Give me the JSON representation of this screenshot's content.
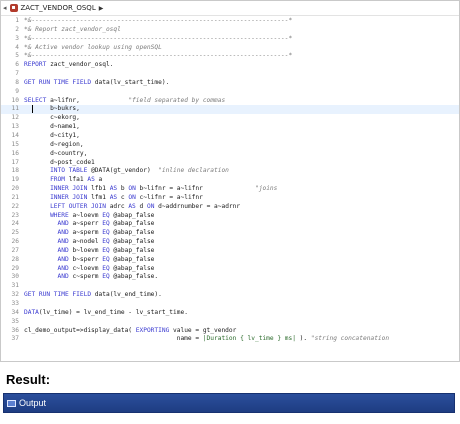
{
  "editor": {
    "breadcrumb": {
      "object_name": "ZACT_VENDOR_OSQL"
    },
    "lines": [
      {
        "n": "1",
        "parts": [
          {
            "t": "*&---------------------------------------------------------------------*",
            "c": "cm"
          }
        ]
      },
      {
        "n": "2",
        "parts": [
          {
            "t": "*& Report zact_vendor_osql",
            "c": "cm"
          }
        ]
      },
      {
        "n": "3",
        "parts": [
          {
            "t": "*&---------------------------------------------------------------------*",
            "c": "cm"
          }
        ]
      },
      {
        "n": "4",
        "parts": [
          {
            "t": "*& Active vendor lookup using openSQL",
            "c": "cm"
          }
        ]
      },
      {
        "n": "5",
        "parts": [
          {
            "t": "*&---------------------------------------------------------------------*",
            "c": "cm"
          }
        ]
      },
      {
        "n": "6",
        "parts": [
          {
            "t": "REPORT",
            "c": "kw"
          },
          {
            "t": " zact_vendor_osql.",
            "c": ""
          }
        ]
      },
      {
        "n": "7",
        "parts": []
      },
      {
        "n": "8",
        "parts": [
          {
            "t": "GET RUN TIME FIELD",
            "c": "kw"
          },
          {
            "t": " data(lv_start_time).",
            "c": ""
          }
        ]
      },
      {
        "n": "9",
        "parts": []
      },
      {
        "n": "10",
        "parts": [
          {
            "t": "SELECT",
            "c": "kw"
          },
          {
            "t": " a~lifnr,             ",
            "c": ""
          },
          {
            "t": "\"field separated by commas",
            "c": "cm"
          }
        ]
      },
      {
        "n": "11",
        "parts": [
          {
            "t": "       b~bukrs,",
            "c": ""
          }
        ],
        "cur": true
      },
      {
        "n": "12",
        "parts": [
          {
            "t": "       c~ekorg,",
            "c": ""
          }
        ]
      },
      {
        "n": "13",
        "parts": [
          {
            "t": "       d~name1,",
            "c": ""
          }
        ]
      },
      {
        "n": "14",
        "parts": [
          {
            "t": "       d~city1,",
            "c": ""
          }
        ]
      },
      {
        "n": "15",
        "parts": [
          {
            "t": "       d~region,",
            "c": ""
          }
        ]
      },
      {
        "n": "16",
        "parts": [
          {
            "t": "       d~country,",
            "c": ""
          }
        ]
      },
      {
        "n": "17",
        "parts": [
          {
            "t": "       d~post_code1",
            "c": ""
          }
        ]
      },
      {
        "n": "18",
        "parts": [
          {
            "t": "       ",
            "c": ""
          },
          {
            "t": "INTO TABLE",
            "c": "kw"
          },
          {
            "t": " @DATA(gt_vendor)  ",
            "c": ""
          },
          {
            "t": "\"inline declaration",
            "c": "cm"
          }
        ]
      },
      {
        "n": "19",
        "parts": [
          {
            "t": "       ",
            "c": ""
          },
          {
            "t": "FROM",
            "c": "kw"
          },
          {
            "t": " lfa1 ",
            "c": ""
          },
          {
            "t": "AS",
            "c": "kw"
          },
          {
            "t": " a",
            "c": ""
          }
        ]
      },
      {
        "n": "20",
        "parts": [
          {
            "t": "       ",
            "c": ""
          },
          {
            "t": "INNER JOIN",
            "c": "kw"
          },
          {
            "t": " lfb1 ",
            "c": ""
          },
          {
            "t": "AS",
            "c": "kw"
          },
          {
            "t": " b ",
            "c": ""
          },
          {
            "t": "ON",
            "c": "kw"
          },
          {
            "t": " b~lifnr = a~lifnr              ",
            "c": ""
          },
          {
            "t": "\"joins",
            "c": "cm"
          }
        ]
      },
      {
        "n": "21",
        "parts": [
          {
            "t": "       ",
            "c": ""
          },
          {
            "t": "INNER JOIN",
            "c": "kw"
          },
          {
            "t": " lfm1 ",
            "c": ""
          },
          {
            "t": "AS",
            "c": "kw"
          },
          {
            "t": " c ",
            "c": ""
          },
          {
            "t": "ON",
            "c": "kw"
          },
          {
            "t": " c~lifnr = a~lifnr",
            "c": ""
          }
        ]
      },
      {
        "n": "22",
        "parts": [
          {
            "t": "       ",
            "c": ""
          },
          {
            "t": "LEFT OUTER JOIN",
            "c": "kw"
          },
          {
            "t": " adrc ",
            "c": ""
          },
          {
            "t": "AS",
            "c": "kw"
          },
          {
            "t": " d ",
            "c": ""
          },
          {
            "t": "ON",
            "c": "kw"
          },
          {
            "t": " d~addrnumber = a~adrnr",
            "c": ""
          }
        ]
      },
      {
        "n": "23",
        "parts": [
          {
            "t": "       ",
            "c": ""
          },
          {
            "t": "WHERE",
            "c": "kw"
          },
          {
            "t": " a~loevm ",
            "c": ""
          },
          {
            "t": "EQ",
            "c": "kw"
          },
          {
            "t": " @abap_false",
            "c": ""
          }
        ]
      },
      {
        "n": "24",
        "parts": [
          {
            "t": "         ",
            "c": ""
          },
          {
            "t": "AND",
            "c": "kw"
          },
          {
            "t": " a~sperr ",
            "c": ""
          },
          {
            "t": "EQ",
            "c": "kw"
          },
          {
            "t": " @abap_false",
            "c": ""
          }
        ]
      },
      {
        "n": "25",
        "parts": [
          {
            "t": "         ",
            "c": ""
          },
          {
            "t": "AND",
            "c": "kw"
          },
          {
            "t": " a~sperm ",
            "c": ""
          },
          {
            "t": "EQ",
            "c": "kw"
          },
          {
            "t": " @abap_false",
            "c": ""
          }
        ]
      },
      {
        "n": "26",
        "parts": [
          {
            "t": "         ",
            "c": ""
          },
          {
            "t": "AND",
            "c": "kw"
          },
          {
            "t": " a~nodel ",
            "c": ""
          },
          {
            "t": "EQ",
            "c": "kw"
          },
          {
            "t": " @abap_false",
            "c": ""
          }
        ]
      },
      {
        "n": "27",
        "parts": [
          {
            "t": "         ",
            "c": ""
          },
          {
            "t": "AND",
            "c": "kw"
          },
          {
            "t": " b~loevm ",
            "c": ""
          },
          {
            "t": "EQ",
            "c": "kw"
          },
          {
            "t": " @abap_false",
            "c": ""
          }
        ]
      },
      {
        "n": "28",
        "parts": [
          {
            "t": "         ",
            "c": ""
          },
          {
            "t": "AND",
            "c": "kw"
          },
          {
            "t": " b~sperr ",
            "c": ""
          },
          {
            "t": "EQ",
            "c": "kw"
          },
          {
            "t": " @abap_false",
            "c": ""
          }
        ]
      },
      {
        "n": "29",
        "parts": [
          {
            "t": "         ",
            "c": ""
          },
          {
            "t": "AND",
            "c": "kw"
          },
          {
            "t": " c~loevm ",
            "c": ""
          },
          {
            "t": "EQ",
            "c": "kw"
          },
          {
            "t": " @abap_false",
            "c": ""
          }
        ]
      },
      {
        "n": "30",
        "parts": [
          {
            "t": "         ",
            "c": ""
          },
          {
            "t": "AND",
            "c": "kw"
          },
          {
            "t": " c~sperm ",
            "c": ""
          },
          {
            "t": "EQ",
            "c": "kw"
          },
          {
            "t": " @abap_false.",
            "c": ""
          }
        ]
      },
      {
        "n": "31",
        "parts": []
      },
      {
        "n": "32",
        "parts": [
          {
            "t": "GET RUN TIME FIELD",
            "c": "kw"
          },
          {
            "t": " data(lv_end_time).",
            "c": ""
          }
        ]
      },
      {
        "n": "33",
        "parts": []
      },
      {
        "n": "34",
        "parts": [
          {
            "t": "DATA",
            "c": "kw"
          },
          {
            "t": "(lv_time) = lv_end_time - lv_start_time.",
            "c": ""
          }
        ]
      },
      {
        "n": "35",
        "parts": []
      },
      {
        "n": "36",
        "parts": [
          {
            "t": "cl_demo_output=>display_data( ",
            "c": ""
          },
          {
            "t": "EXPORTING",
            "c": "kw"
          },
          {
            "t": " value = gt_vendor",
            "c": ""
          }
        ]
      },
      {
        "n": "37",
        "parts": [
          {
            "t": "                                         name = ",
            "c": ""
          },
          {
            "t": "|Duration { lv_time } ms|",
            "c": "st"
          },
          {
            "t": " ). ",
            "c": ""
          },
          {
            "t": "\"string concatenation",
            "c": "cm"
          }
        ]
      }
    ]
  },
  "result_heading": "Result:",
  "output_window": {
    "title": "Output"
  },
  "colors": {
    "keyword": "#3a3ad0",
    "comment": "#7a7a7a",
    "string": "#2a6a2a",
    "output_bar": "#2b4f9c"
  }
}
